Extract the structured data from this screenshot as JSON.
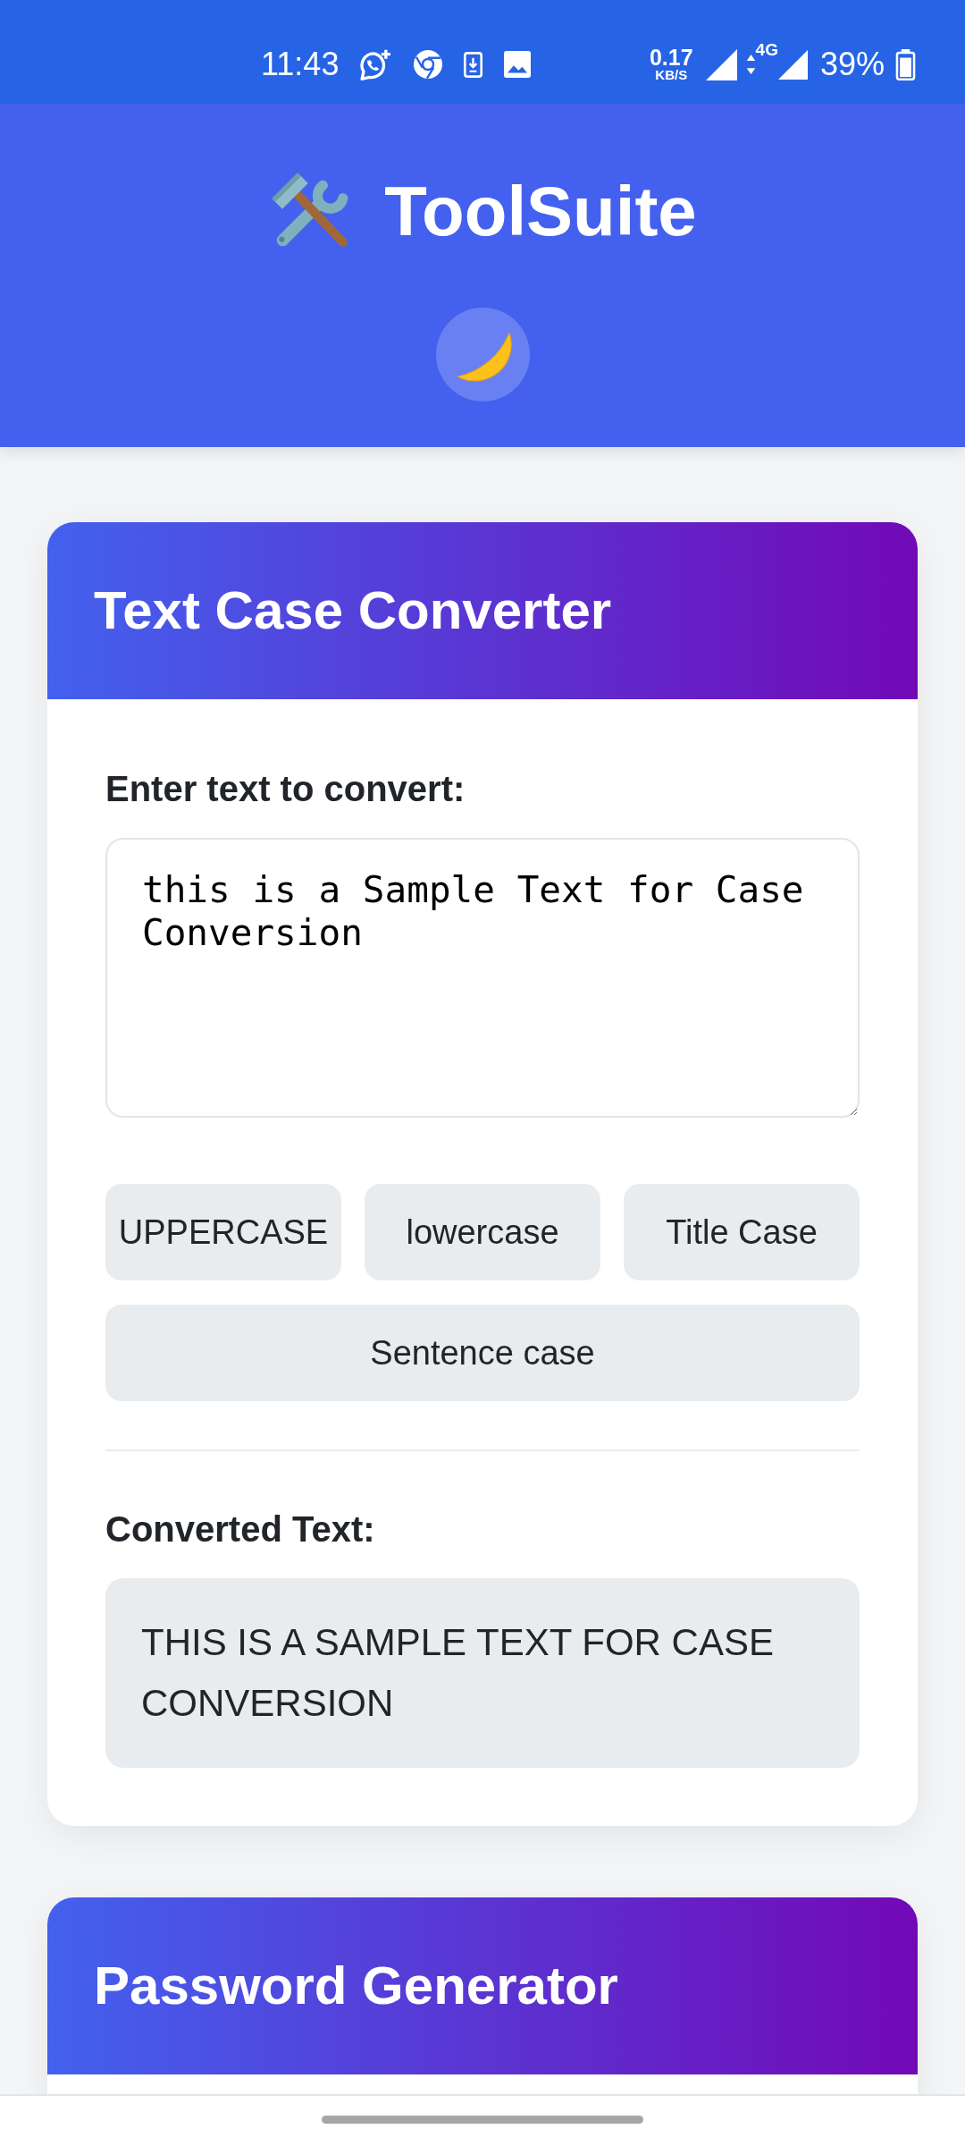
{
  "status_bar": {
    "time": "11:43",
    "net_speed": "0.17",
    "net_speed_unit": "KB/S",
    "network_type": "4G",
    "battery": "39%"
  },
  "header": {
    "title": "ToolSuite"
  },
  "tools": [
    {
      "title": "Text Case Converter",
      "input_label": "Enter text to convert:",
      "input_value": "this is a Sample Text for Case Conversion",
      "buttons": [
        "UPPERCASE",
        "lowercase",
        "Title Case",
        "Sentence case"
      ],
      "output_label": "Converted Text:",
      "output_text": "THIS IS A SAMPLE TEXT FOR CASE CONVERSION"
    },
    {
      "title": "Password Generator"
    }
  ]
}
